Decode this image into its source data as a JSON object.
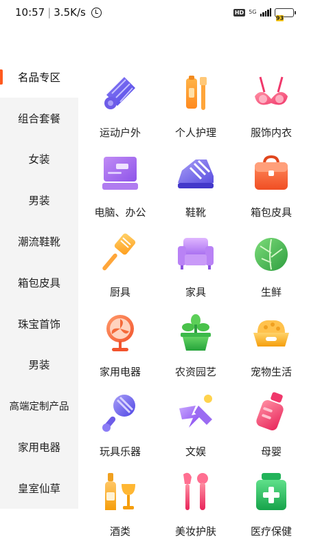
{
  "status_bar": {
    "time": "10:57",
    "separator": "|",
    "speed": "3.5K/s",
    "hd": "HD",
    "network": "5G",
    "battery": "93"
  },
  "sidebar": {
    "items": [
      {
        "label": "名品专区"
      },
      {
        "label": "组合套餐"
      },
      {
        "label": "女装"
      },
      {
        "label": "男装"
      },
      {
        "label": "潮流鞋靴"
      },
      {
        "label": "箱包皮具"
      },
      {
        "label": "珠宝首饰"
      },
      {
        "label": "男装"
      },
      {
        "label": "高端定制产品"
      },
      {
        "label": "家用电器"
      },
      {
        "label": "皇室仙草"
      }
    ],
    "active_index": 0
  },
  "categories": [
    {
      "label": "运动户外",
      "icon": "badminton-shuttlecock-icon"
    },
    {
      "label": "个人护理",
      "icon": "toothbrush-toothpaste-icon"
    },
    {
      "label": "服饰内衣",
      "icon": "bra-icon"
    },
    {
      "label": "电脑、办公",
      "icon": "laptop-icon"
    },
    {
      "label": "鞋靴",
      "icon": "sneaker-icon"
    },
    {
      "label": "箱包皮具",
      "icon": "handbag-icon"
    },
    {
      "label": "厨具",
      "icon": "spatula-icon"
    },
    {
      "label": "家具",
      "icon": "sofa-icon"
    },
    {
      "label": "生鲜",
      "icon": "cabbage-icon"
    },
    {
      "label": "家用电器",
      "icon": "fan-icon"
    },
    {
      "label": "农资园艺",
      "icon": "potted-plant-icon"
    },
    {
      "label": "宠物生活",
      "icon": "pet-food-bowl-icon"
    },
    {
      "label": "玩具乐器",
      "icon": "rattle-icon"
    },
    {
      "label": "文娱",
      "icon": "entertainment-icon"
    },
    {
      "label": "母婴",
      "icon": "baby-bottle-icon"
    },
    {
      "label": "酒类",
      "icon": "wine-icon"
    },
    {
      "label": "美妆护肤",
      "icon": "makeup-brush-icon"
    },
    {
      "label": "医疗保健",
      "icon": "medicine-bottle-icon"
    }
  ],
  "colors": {
    "accent": "#ff5a1f",
    "sidebar_bg": "#f4f4f4",
    "battery": "#f5c518"
  }
}
